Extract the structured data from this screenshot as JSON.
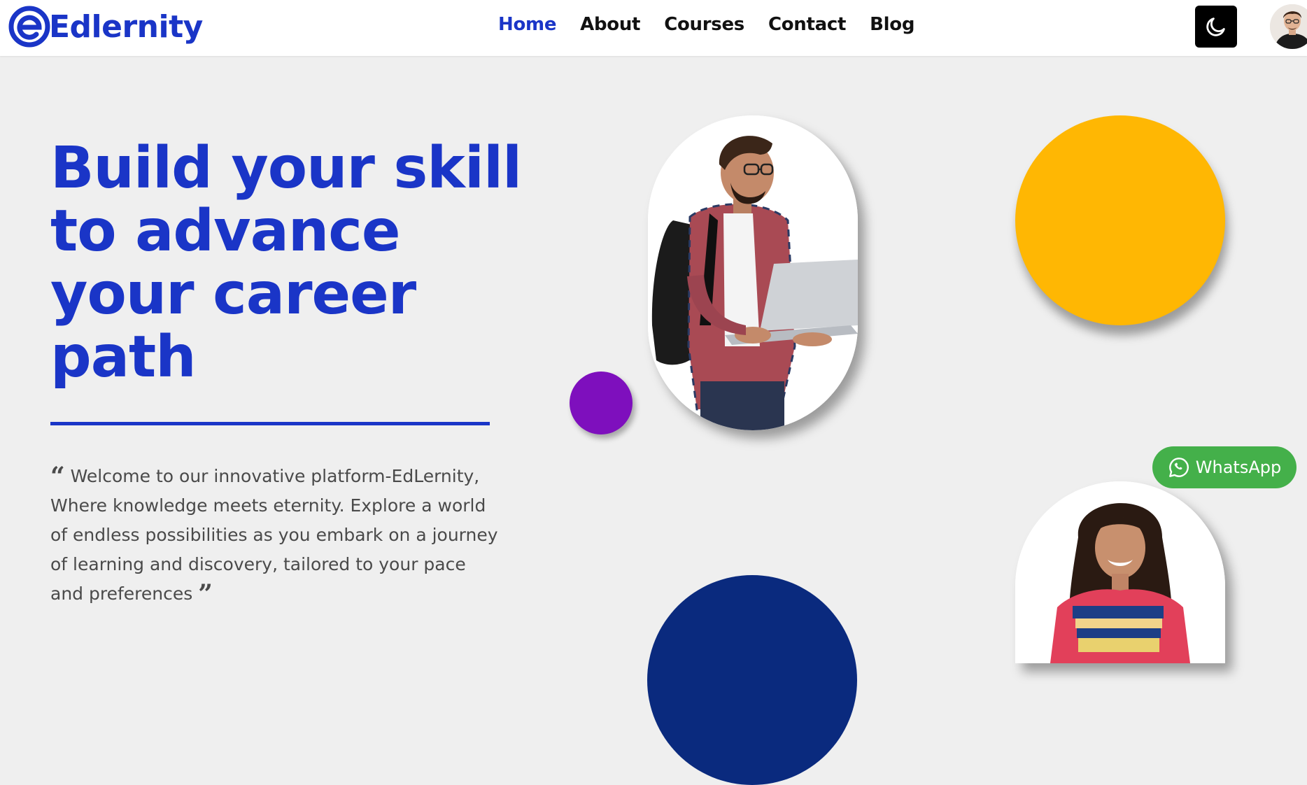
{
  "brand": {
    "name": "Edlernity",
    "color": "#1a35c7"
  },
  "nav": {
    "items": [
      {
        "label": "Home",
        "active": true
      },
      {
        "label": "About",
        "active": false
      },
      {
        "label": "Courses",
        "active": false
      },
      {
        "label": "Contact",
        "active": false
      },
      {
        "label": "Blog",
        "active": false
      }
    ],
    "theme_toggle_icon": "moon-icon",
    "avatar_icon": "user-avatar"
  },
  "hero": {
    "title_lines": [
      "Build your skill",
      "to advance",
      "your career",
      "path"
    ],
    "description": "Welcome to our innovative platform-EdLernity, Where knowledge meets eternity. Explore a world of endless possibilities as you embark on a journey of learning and discovery, tailored to your pace and preferences",
    "quote_open": "“",
    "quote_close": "”"
  },
  "decor": {
    "yellow": "#ffb703",
    "purple": "#7e0fbd",
    "navy": "#0a2a7e"
  },
  "whatsapp": {
    "label": "WhatsApp",
    "icon": "whatsapp-icon",
    "color": "#44b04a"
  }
}
